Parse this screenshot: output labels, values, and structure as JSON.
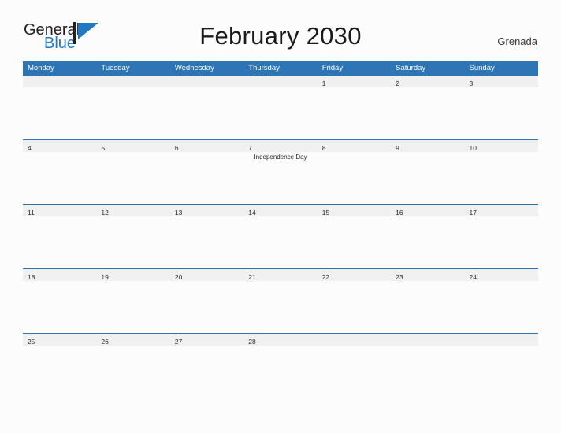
{
  "brand": {
    "name_part1": "General",
    "name_part2": "Blue",
    "flag_color": "#2079c4",
    "text_color": "#231f20"
  },
  "header": {
    "title": "February 2030",
    "country": "Grenada",
    "accent_color": "#2e75b6"
  },
  "calendar": {
    "weekdays": [
      "Monday",
      "Tuesday",
      "Wednesday",
      "Thursday",
      "Friday",
      "Saturday",
      "Sunday"
    ],
    "weeks": [
      {
        "days": [
          {
            "date": "",
            "event": ""
          },
          {
            "date": "",
            "event": ""
          },
          {
            "date": "",
            "event": ""
          },
          {
            "date": "",
            "event": ""
          },
          {
            "date": "1",
            "event": ""
          },
          {
            "date": "2",
            "event": ""
          },
          {
            "date": "3",
            "event": ""
          }
        ]
      },
      {
        "days": [
          {
            "date": "4",
            "event": ""
          },
          {
            "date": "5",
            "event": ""
          },
          {
            "date": "6",
            "event": ""
          },
          {
            "date": "7",
            "event": "Independence Day"
          },
          {
            "date": "8",
            "event": ""
          },
          {
            "date": "9",
            "event": ""
          },
          {
            "date": "10",
            "event": ""
          }
        ]
      },
      {
        "days": [
          {
            "date": "11",
            "event": ""
          },
          {
            "date": "12",
            "event": ""
          },
          {
            "date": "13",
            "event": ""
          },
          {
            "date": "14",
            "event": ""
          },
          {
            "date": "15",
            "event": ""
          },
          {
            "date": "16",
            "event": ""
          },
          {
            "date": "17",
            "event": ""
          }
        ]
      },
      {
        "days": [
          {
            "date": "18",
            "event": ""
          },
          {
            "date": "19",
            "event": ""
          },
          {
            "date": "20",
            "event": ""
          },
          {
            "date": "21",
            "event": ""
          },
          {
            "date": "22",
            "event": ""
          },
          {
            "date": "23",
            "event": ""
          },
          {
            "date": "24",
            "event": ""
          }
        ]
      },
      {
        "days": [
          {
            "date": "25",
            "event": ""
          },
          {
            "date": "26",
            "event": ""
          },
          {
            "date": "27",
            "event": ""
          },
          {
            "date": "28",
            "event": ""
          },
          {
            "date": "",
            "event": ""
          },
          {
            "date": "",
            "event": ""
          },
          {
            "date": "",
            "event": ""
          }
        ]
      }
    ]
  }
}
